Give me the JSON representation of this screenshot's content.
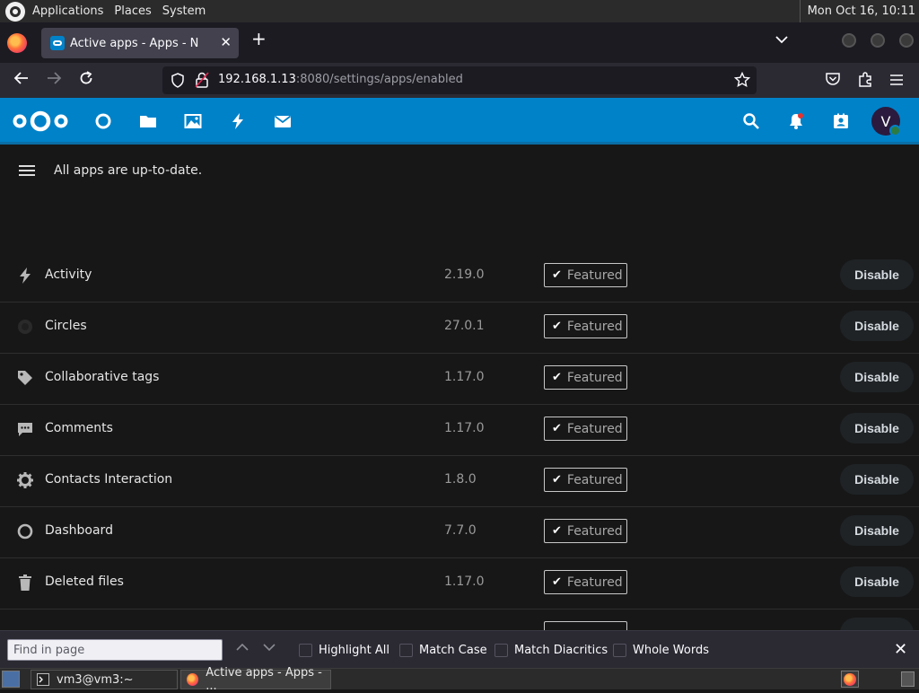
{
  "panel": {
    "menus": [
      "Applications",
      "Places",
      "System"
    ],
    "clock": "Mon Oct 16, 10:11"
  },
  "browser": {
    "tab_title": "Active apps - Apps - N",
    "url_host": "192.168.1.13",
    "url_rest": ":8080/settings/apps/enabled"
  },
  "nextcloud": {
    "header_icons": [
      "nextcloud-logo",
      "dashboard-icon",
      "files-icon",
      "photos-icon",
      "activity-icon",
      "mail-icon"
    ],
    "right_icons": [
      "search-icon",
      "notifications-icon",
      "contacts-icon"
    ],
    "avatar_letter": "V",
    "accent": "#0082c9"
  },
  "content": {
    "status_message": "All apps are up-to-date.",
    "badge_label": "Featured",
    "disable_label": "Disable",
    "apps": [
      {
        "name": "Activity",
        "version": "2.19.0",
        "icon": "activity-icon"
      },
      {
        "name": "Circles",
        "version": "27.0.1",
        "icon": "circles-icon"
      },
      {
        "name": "Collaborative tags",
        "version": "1.17.0",
        "icon": "tag-icon"
      },
      {
        "name": "Comments",
        "version": "1.17.0",
        "icon": "comments-icon"
      },
      {
        "name": "Contacts Interaction",
        "version": "1.8.0",
        "icon": "gear-icon"
      },
      {
        "name": "Dashboard",
        "version": "7.7.0",
        "icon": "dashboard-icon"
      },
      {
        "name": "Deleted files",
        "version": "1.17.0",
        "icon": "trash-icon"
      }
    ]
  },
  "find_bar": {
    "placeholder": "Find in page",
    "options": [
      "Highlight All",
      "Match Case",
      "Match Diacritics",
      "Whole Words"
    ]
  },
  "taskbar": {
    "tasks": [
      "vm3@vm3:~",
      "Active apps - Apps - ..."
    ]
  }
}
